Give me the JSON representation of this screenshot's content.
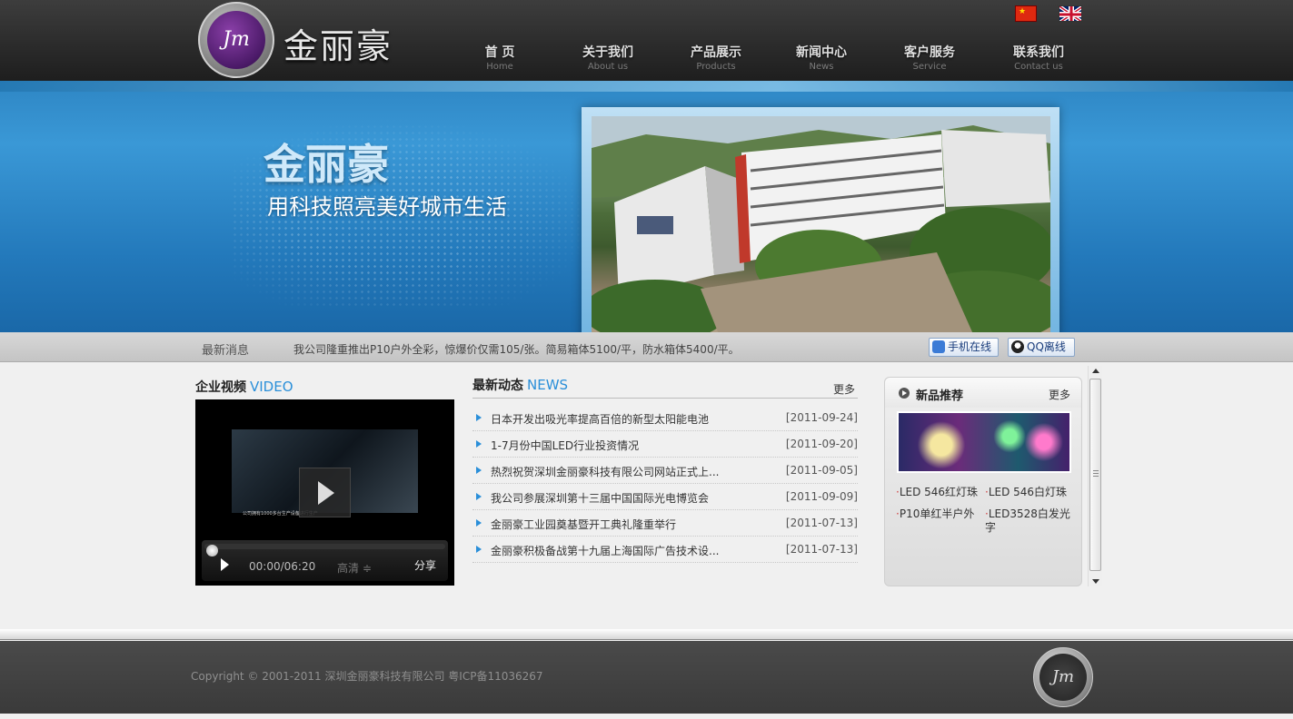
{
  "header": {
    "logo_monogram": "Jm",
    "logo_text": "金丽豪",
    "nav": [
      {
        "cn": "首 页",
        "en": "Home"
      },
      {
        "cn": "关于我们",
        "en": "About us"
      },
      {
        "cn": "产品展示",
        "en": "Products"
      },
      {
        "cn": "新闻中心",
        "en": "News"
      },
      {
        "cn": "客户服务",
        "en": "Service"
      },
      {
        "cn": "联系我们",
        "en": "Contact us"
      }
    ],
    "languages": [
      "chinese-flag-icon",
      "uk-flag-icon"
    ]
  },
  "banner": {
    "brand": "金丽豪",
    "slogan": "用科技照亮美好城市生活"
  },
  "ticker": {
    "label": "最新消息",
    "message": "我公司隆重推出P10户外全彩，惊爆价仅需105/张。简易箱体5100/平，防水箱体5400/平。",
    "mobile_button": "手机在线",
    "qq_button": "QQ离线"
  },
  "video": {
    "title_cn": "企业视频",
    "title_en": "VIDEO",
    "time": "00:00/06:20",
    "quality": "高清 ≑",
    "share": "分享",
    "caption": "公司拥有1000多台生产设备进行生产"
  },
  "news": {
    "title_cn": "最新动态",
    "title_en": "NEWS",
    "more": "更多",
    "items": [
      {
        "title": "日本开发出吸光率提高百倍的新型太阳能电池",
        "date": "[2011-09-24]"
      },
      {
        "title": "1-7月份中国LED行业投资情况",
        "date": "[2011-09-20]"
      },
      {
        "title": "热烈祝贺深圳金丽豪科技有限公司网站正式上...",
        "date": "[2011-09-05]"
      },
      {
        "title": "我公司参展深圳第十三届中国国际光电博览会",
        "date": "[2011-09-09]"
      },
      {
        "title": "金丽豪工业园奠基暨开工典礼隆重举行",
        "date": "[2011-07-13]"
      },
      {
        "title": "金丽豪积极备战第十九届上海国际广告技术设...",
        "date": "[2011-07-13]"
      }
    ]
  },
  "products": {
    "title": "新品推荐",
    "more": "更多",
    "items": [
      "LED 546红灯珠",
      "LED 546白灯珠",
      "P10单红半户外",
      "LED3528白发光字"
    ]
  },
  "footer": {
    "copyright": "Copyright © 2001-2011 深圳金丽豪科技有限公司   粤ICP备11036267",
    "logo_monogram": "Jm"
  },
  "colors": {
    "accent_blue": "#2a8fd9",
    "header_dark": "#2a2a2a",
    "banner_blue": "#2379bb",
    "footer_gray": "#444444"
  }
}
